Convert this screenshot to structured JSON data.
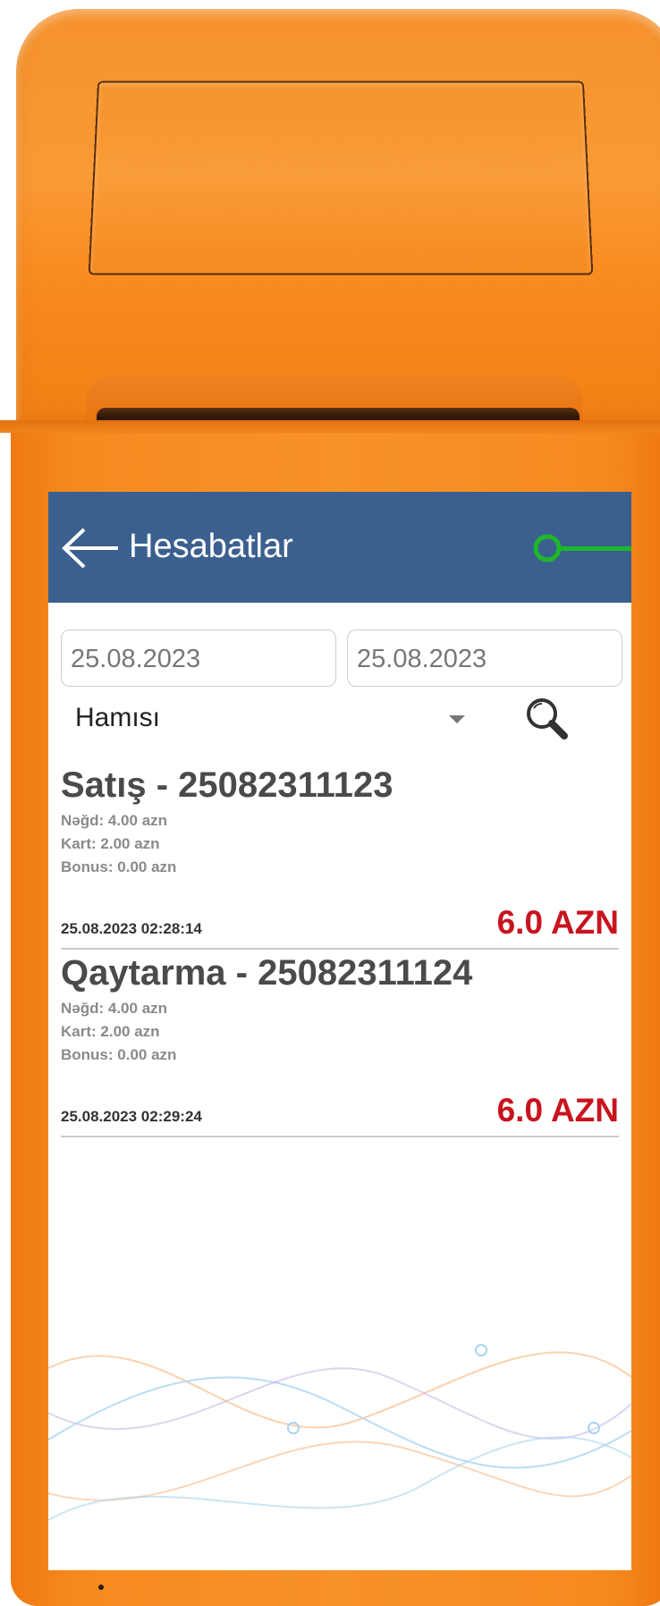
{
  "header": {
    "title": "Hesabatlar"
  },
  "filters": {
    "date_from": "25.08.2023",
    "date_to": "25.08.2023",
    "type_selected": "Hamısı"
  },
  "transactions": [
    {
      "title": "Satış - 25082311123",
      "cash": "Nəğd: 4.00  azn",
      "card": "Kart: 2.00  azn",
      "bonus": "Bonus: 0.00  azn",
      "datetime": "25.08.2023 02:28:14",
      "amount": "6.0 AZN"
    },
    {
      "title": "Qaytarma - 25082311124",
      "cash": "Nəğd: 4.00  azn",
      "card": "Kart: 2.00  azn",
      "bonus": "Bonus: 0.00  azn",
      "datetime": "25.08.2023 02:29:24",
      "amount": "6.0 AZN"
    }
  ],
  "colors": {
    "device_orange": "#f58a20",
    "app_bar": "#3b6090",
    "amount_red": "#c8141e",
    "pointer_green": "#1db82a"
  },
  "icons": {
    "back": "arrow-left-icon",
    "search": "search-icon",
    "dropdown": "chevron-down-icon"
  }
}
